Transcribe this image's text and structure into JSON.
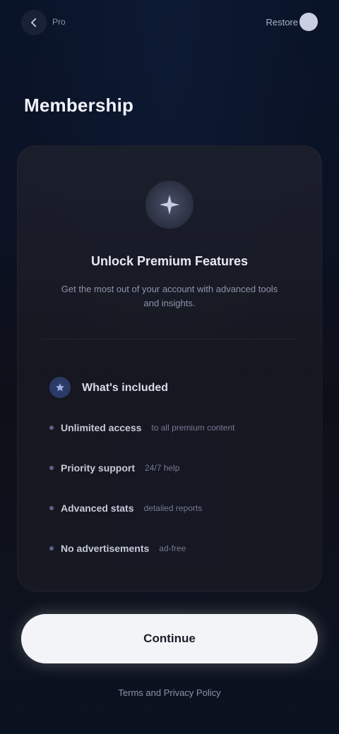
{
  "topbar": {
    "back_icon": "chevron-left-icon",
    "brand": "Pro",
    "action_label": "Restore",
    "avatar_icon": "user-avatar"
  },
  "page": {
    "title": "Membership"
  },
  "hero": {
    "icon": "sparkle-icon",
    "title": "Unlock Premium Features",
    "subtitle": "Get the most out of your account with advanced tools and insights."
  },
  "section": {
    "icon": "star-icon",
    "title": "What's included",
    "features": [
      {
        "label": "Unlimited access",
        "detail": "to all premium content"
      },
      {
        "label": "Priority support",
        "detail": "24/7 help"
      },
      {
        "label": "Advanced stats",
        "detail": "detailed reports"
      },
      {
        "label": "No advertisements",
        "detail": "ad-free"
      }
    ]
  },
  "cta": {
    "label": "Continue"
  },
  "footer": {
    "link": "Terms and Privacy Policy"
  },
  "colors": {
    "background": "#0b1224",
    "card": "#1c202d",
    "cta": "#f3f4f8",
    "accent": "#2b3a66"
  }
}
